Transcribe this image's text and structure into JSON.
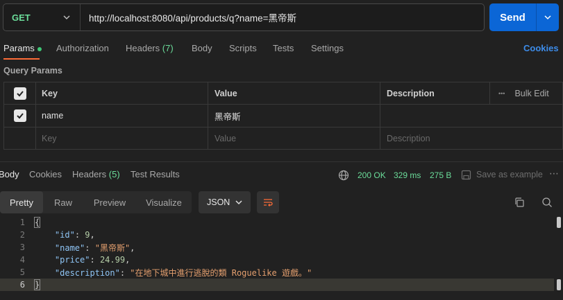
{
  "request": {
    "method": "GET",
    "url": "http://localhost:8080/api/products/q?name=黑帝斯",
    "send_label": "Send"
  },
  "request_tabs": [
    {
      "label": "Params",
      "active": true
    },
    {
      "label": "Authorization"
    },
    {
      "label": "Headers",
      "count": "(7)"
    },
    {
      "label": "Body"
    },
    {
      "label": "Scripts"
    },
    {
      "label": "Tests"
    },
    {
      "label": "Settings"
    }
  ],
  "cookies_link": "Cookies",
  "query_params": {
    "title": "Query Params",
    "headers": {
      "key": "Key",
      "value": "Value",
      "description": "Description",
      "bulk_edit": "Bulk Edit"
    },
    "rows": [
      {
        "checked": true,
        "key": "name",
        "value": "黑帝斯",
        "description": ""
      }
    ],
    "placeholder": {
      "key": "Key",
      "value": "Value",
      "description": "Description"
    }
  },
  "response_tabs": [
    {
      "label": "Body",
      "active": true
    },
    {
      "label": "Cookies"
    },
    {
      "label": "Headers",
      "count": "(5)"
    },
    {
      "label": "Test Results"
    }
  ],
  "response_status": {
    "status": "200 OK",
    "time": "329 ms",
    "size": "275 B",
    "save_label": "Save as example"
  },
  "view_modes": [
    "Pretty",
    "Raw",
    "Preview",
    "Visualize"
  ],
  "format": "JSON",
  "body_lines": [
    {
      "n": "1",
      "text": "{"
    },
    {
      "n": "2",
      "key": "\"id\"",
      "val": "9",
      "type": "num"
    },
    {
      "n": "3",
      "key": "\"name\"",
      "val": "\"黑帝斯\"",
      "type": "str"
    },
    {
      "n": "4",
      "key": "\"price\"",
      "val": "24.99",
      "type": "num"
    },
    {
      "n": "5",
      "key": "\"description\"",
      "val": "\"在地下城中進行逃脫的類 Roguelike 遊戲。\"",
      "type": "str",
      "last": true
    },
    {
      "n": "6",
      "text": "}"
    }
  ],
  "colors": {
    "accent": "#ff6c37",
    "send": "#0b66d6",
    "status_ok": "#6bdd9a",
    "link": "#3d8ce9"
  }
}
